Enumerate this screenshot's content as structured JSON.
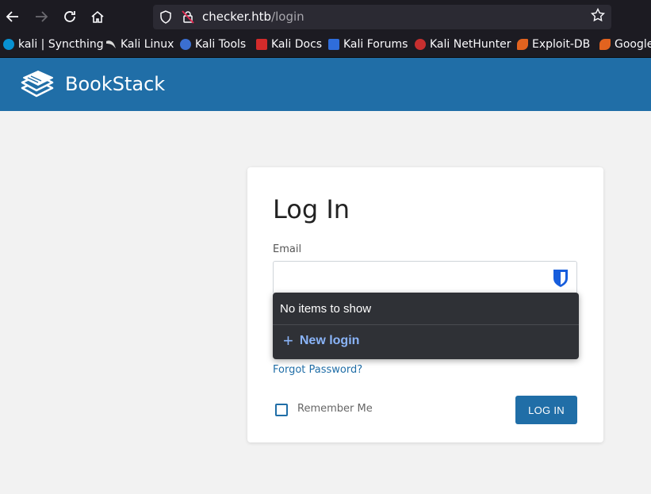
{
  "browser": {
    "url_host": "checker.htb",
    "url_path": "/login",
    "bookmarks": [
      {
        "label": "kali | Syncthing",
        "icon": "syncthing-icon"
      },
      {
        "label": "Kali Linux",
        "icon": "kali-dragon-icon"
      },
      {
        "label": "Kali Tools",
        "icon": "kali-tools-icon"
      },
      {
        "label": "Kali Docs",
        "icon": "kali-docs-icon"
      },
      {
        "label": "Kali Forums",
        "icon": "kali-forums-icon"
      },
      {
        "label": "Kali NetHunter",
        "icon": "nethunter-icon"
      },
      {
        "label": "Exploit-DB",
        "icon": "exploit-db-icon"
      },
      {
        "label": "Google",
        "icon": "google-hacking-icon"
      }
    ]
  },
  "app": {
    "brand": "BookStack",
    "header_color": "#206ea7"
  },
  "login": {
    "title": "Log In",
    "email_label": "Email",
    "email_value": "",
    "forgot_link": "Forgot Password?",
    "remember_label": "Remember Me",
    "remember_checked": false,
    "submit_label": "LOG IN"
  },
  "autofill": {
    "empty_text": "No items to show",
    "new_login_label": "New login"
  }
}
